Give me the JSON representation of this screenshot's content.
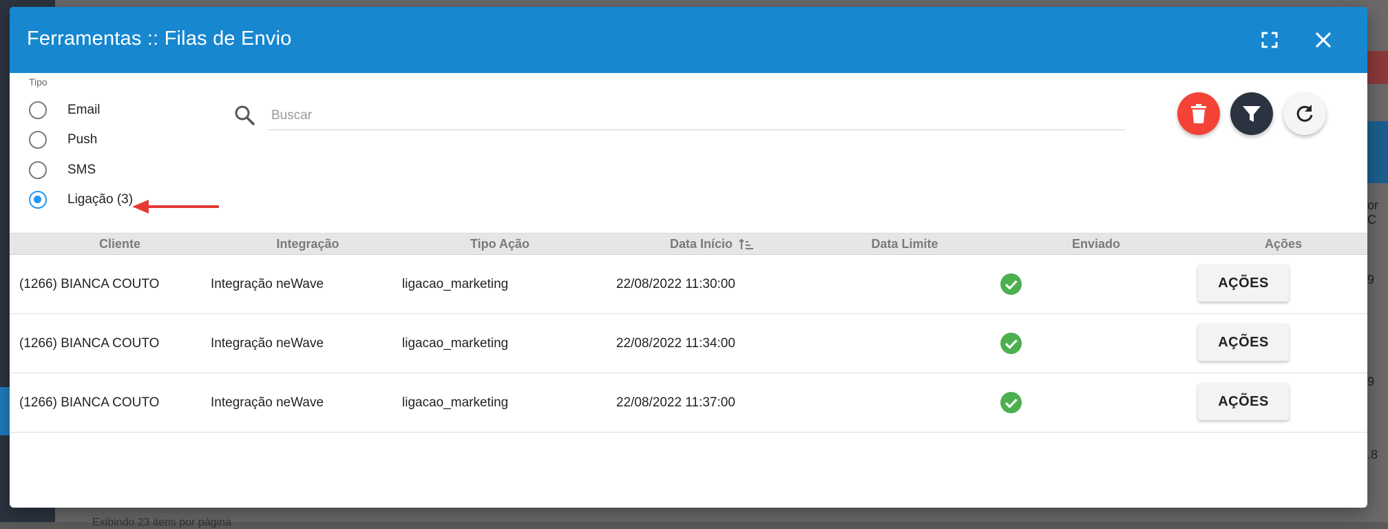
{
  "modal": {
    "title": "Ferramentas :: Filas de Envio"
  },
  "filters": {
    "tipo_label": "Tipo",
    "options": [
      {
        "label": "Email",
        "checked": false
      },
      {
        "label": "Push",
        "checked": false
      },
      {
        "label": "SMS",
        "checked": false
      },
      {
        "label": "Ligação (3)",
        "checked": true
      }
    ]
  },
  "search": {
    "placeholder": "Buscar",
    "value": ""
  },
  "actions": {
    "delete_icon": "trash-icon",
    "filter_icon": "filter-icon",
    "refresh_icon": "refresh-icon"
  },
  "table": {
    "columns": [
      "Cliente",
      "Integração",
      "Tipo Ação",
      "Data Início",
      "Data Limite",
      "Enviado",
      "Ações"
    ],
    "rows": [
      {
        "cliente": "(1266) BIANCA COUTO",
        "integracao": "Integração neWave",
        "tipo_acao": "ligacao_marketing",
        "data_inicio": "22/08/2022 11:30:00",
        "data_limite": "",
        "enviado": true,
        "acoes": "AÇÕES"
      },
      {
        "cliente": "(1266) BIANCA COUTO",
        "integracao": "Integração neWave",
        "tipo_acao": "ligacao_marketing",
        "data_inicio": "22/08/2022 11:34:00",
        "data_limite": "",
        "enviado": true,
        "acoes": "AÇÕES"
      },
      {
        "cliente": "(1266) BIANCA COUTO",
        "integracao": "Integração neWave",
        "tipo_acao": "ligacao_marketing",
        "data_inicio": "22/08/2022 11:37:00",
        "data_limite": "",
        "enviado": true,
        "acoes": "AÇÕES"
      }
    ]
  },
  "background": {
    "right_texts": [
      "or C",
      "9",
      "9",
      ".8"
    ],
    "footer_text": "Exibindo 23 itens por página"
  },
  "colors": {
    "header_blue": "#1787d0",
    "radio_selected": "#2196f3",
    "delete_red": "#f44336",
    "filter_dark": "#2b3340",
    "check_green": "#4caf50",
    "annotation_arrow": "#e53935"
  }
}
